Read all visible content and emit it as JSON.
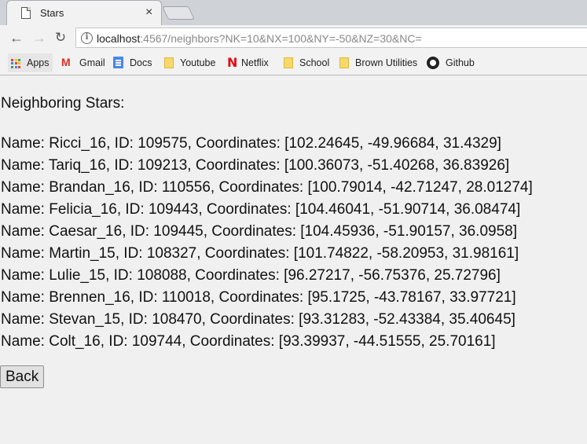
{
  "tab": {
    "title": "Stars",
    "close": "×"
  },
  "address_bar": {
    "host": "localhost",
    "path": ":4567/neighbors?NK=10&NX=100&NY=-50&NZ=30&NC="
  },
  "nav": {
    "back": "←",
    "forward": "→",
    "reload": "↻"
  },
  "bookmarks": [
    {
      "label": "Apps",
      "icon": "apps-grid-icon"
    },
    {
      "label": "Gmail",
      "icon": "gmail-icon"
    },
    {
      "label": "Docs",
      "icon": "docs-icon"
    },
    {
      "label": "Youtube",
      "icon": "folder-icon"
    },
    {
      "label": "Netflix",
      "icon": "netflix-icon"
    },
    {
      "label": "School",
      "icon": "folder-icon"
    },
    {
      "label": "Brown Utilities",
      "icon": "folder-icon"
    },
    {
      "label": "Github",
      "icon": "github-icon"
    }
  ],
  "page": {
    "heading": "Neighboring Stars:",
    "stars": [
      "Name: Ricci_16, ID: 109575, Coordinates: [102.24645, -49.96684, 31.4329]",
      "Name: Tariq_16, ID: 109213, Coordinates: [100.36073, -51.40268, 36.83926]",
      "Name: Brandan_16, ID: 110556, Coordinates: [100.79014, -42.71247, 28.01274]",
      "Name: Felicia_16, ID: 109443, Coordinates: [104.46041, -51.90714, 36.08474]",
      "Name: Caesar_16, ID: 109445, Coordinates: [104.45936, -51.90157, 36.0958]",
      "Name: Martin_15, ID: 108327, Coordinates: [101.74822, -58.20953, 31.98161]",
      "Name: Lulie_15, ID: 108088, Coordinates: [96.27217, -56.75376, 25.72796]",
      "Name: Brennen_16, ID: 110018, Coordinates: [95.1725, -43.78167, 33.97721]",
      "Name: Stevan_15, ID: 108470, Coordinates: [93.31283, -52.43384, 35.40645]",
      "Name: Colt_16, ID: 109744, Coordinates: [93.39937, -44.51555, 25.70161]"
    ],
    "back_button": "Back"
  }
}
